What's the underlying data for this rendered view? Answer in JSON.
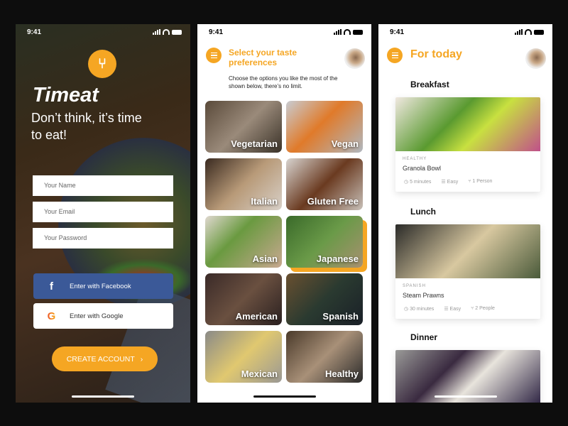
{
  "status_time": "9:41",
  "brand_color": "#f5a623",
  "signup": {
    "logo_icon": "fork-knife-icon",
    "app_name": "Timeat",
    "tagline": "Don’t think, it’s time to eat!",
    "fields": [
      {
        "placeholder": "Your Name"
      },
      {
        "placeholder": "Your Email"
      },
      {
        "placeholder": "Your Password"
      }
    ],
    "facebook_label": "Enter with Facebook",
    "google_label": "Enter with Google",
    "create_label": "CREATE ACCOUNT",
    "create_chevron": "›"
  },
  "preferences": {
    "title": "Select your taste preferences",
    "description": "Choose the options you like the most of the shown below, there’s no limit.",
    "options": [
      {
        "label": "Vegetarian",
        "selected": false,
        "bg": "linear-gradient(135deg,#5a4a3a,#9a8a7a 50%,#3a3228)"
      },
      {
        "label": "Vegan",
        "selected": false,
        "bg": "linear-gradient(135deg,#c8ccd2,#e07a2a 45%,#b0b8c0)"
      },
      {
        "label": "Italian",
        "selected": false,
        "bg": "linear-gradient(135deg,#3a2a20,#b89a78 50%,#d8d0c8)"
      },
      {
        "label": "Gluten Free",
        "selected": false,
        "bg": "linear-gradient(135deg,#d8d4d0,#6a3a20 50%,#c8c0b8)"
      },
      {
        "label": "Asian",
        "selected": false,
        "bg": "linear-gradient(135deg,#e0d8d0,#6a9a40 40%,#c8a890)"
      },
      {
        "label": "Japanese",
        "selected": true,
        "bg": "linear-gradient(135deg,#3a6a2a,#6a9a48 50%,#a89070)"
      },
      {
        "label": "American",
        "selected": false,
        "bg": "linear-gradient(135deg,#3a2a28,#6a5040 50%,#2a2020)"
      },
      {
        "label": "Spanish",
        "selected": false,
        "bg": "linear-gradient(135deg,#6a5030,#2a3a30 50%,#1a2028)"
      },
      {
        "label": "Mexican",
        "selected": false,
        "bg": "linear-gradient(135deg,#8a8a88,#e0c870 50%,#9a9894)"
      },
      {
        "label": "Healthy",
        "selected": false,
        "bg": "linear-gradient(135deg,#4a3a2a,#a89078 50%,#2a2a2a)"
      }
    ]
  },
  "today": {
    "title": "For today",
    "meals": [
      {
        "section": "Breakfast",
        "category": "HEALTHY",
        "name": "Granola Bowl",
        "time": "5 minutes",
        "difficulty": "Easy",
        "servings": "1 Person",
        "bg": "linear-gradient(135deg,#f0e8e0,#5a9a30 40%,#c8e040 60%,#c0508a)"
      },
      {
        "section": "Lunch",
        "category": "SPANISH",
        "name": "Steam Prawns",
        "time": "30 minutes",
        "difficulty": "Easy",
        "servings": "2 People",
        "bg": "linear-gradient(135deg,#2a2a28,#d8c8a0 50%,#4a5a3a)"
      },
      {
        "section": "Dinner",
        "bg": "linear-gradient(135deg,#9a9a98,#3a2a40 35%,#e8e4dc 55%,#2a2040)"
      }
    ]
  }
}
